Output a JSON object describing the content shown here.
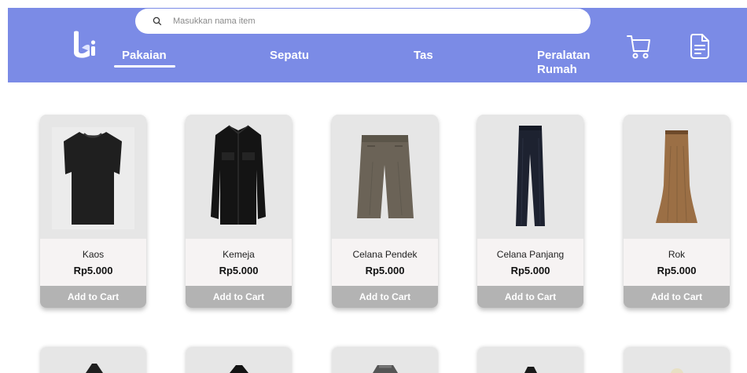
{
  "search": {
    "placeholder": "Masukkan nama item"
  },
  "nav": {
    "items": [
      {
        "label": "Pakaian"
      },
      {
        "label": "Sepatu"
      },
      {
        "label": "Tas"
      },
      {
        "label_line1": "Peralatan",
        "label_line2": "Rumah"
      }
    ]
  },
  "colors": {
    "header": "#7b8be6",
    "card": "#e6e6e6",
    "button": "#b3b3b3"
  },
  "products": [
    {
      "name": "Kaos",
      "price": "Rp5.000",
      "button": "Add to Cart"
    },
    {
      "name": "Kemeja",
      "price": "Rp5.000",
      "button": "Add to Cart"
    },
    {
      "name": "Celana Pendek",
      "price": "Rp5.000",
      "button": "Add to Cart"
    },
    {
      "name": "Celana Panjang",
      "price": "Rp5.000",
      "button": "Add to Cart"
    },
    {
      "name": "Rok",
      "price": "Rp5.000",
      "button": "Add to Cart"
    }
  ],
  "icons": {
    "search": "search-icon",
    "cart": "cart-icon",
    "document": "document-icon",
    "logo": "logo-icon"
  }
}
